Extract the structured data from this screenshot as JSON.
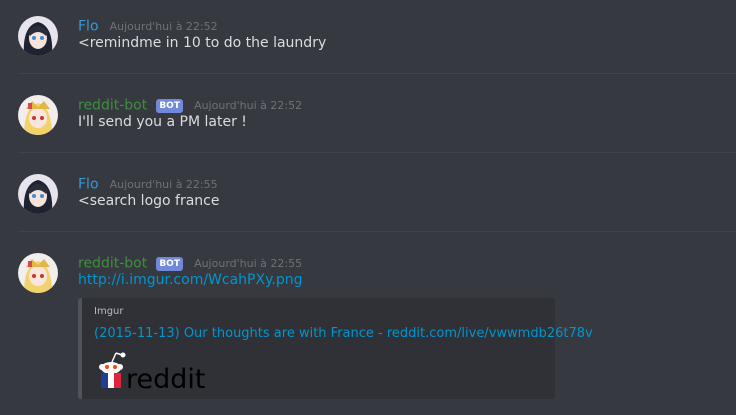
{
  "messages": [
    {
      "author": "Flo",
      "timestamp": "Aujourd'hui à 22:52",
      "content": "<remindme in 10 to do the laundry"
    },
    {
      "author": "reddit-bot",
      "badge": "BOT",
      "timestamp": "Aujourd'hui à 22:52",
      "content": "I'll send you a PM later !"
    },
    {
      "author": "Flo",
      "timestamp": "Aujourd'hui à 22:55",
      "content": "<search logo france"
    },
    {
      "author": "reddit-bot",
      "badge": "BOT",
      "timestamp": "Aujourd'hui à 22:55",
      "link": "http://i.imgur.com/WcahPXy.png",
      "embed": {
        "provider": "Imgur",
        "title": "(2015-11-13) Our thoughts are with France - reddit.com/live/vwwmdb26t78v",
        "image_wordmark": "reddit",
        "image_icon": "reddit-alien-france-icon"
      }
    }
  ],
  "colors": {
    "background": "#36393f",
    "user_name": "#3498db",
    "bot_name": "#3f8f3f",
    "bot_badge": "#7289da",
    "link": "#0096cf",
    "text": "#dcddde"
  },
  "icons": {
    "user_avatar": "anime-girl-avatar-icon",
    "bot_avatar": "anime-girl-blonde-avatar-icon"
  }
}
